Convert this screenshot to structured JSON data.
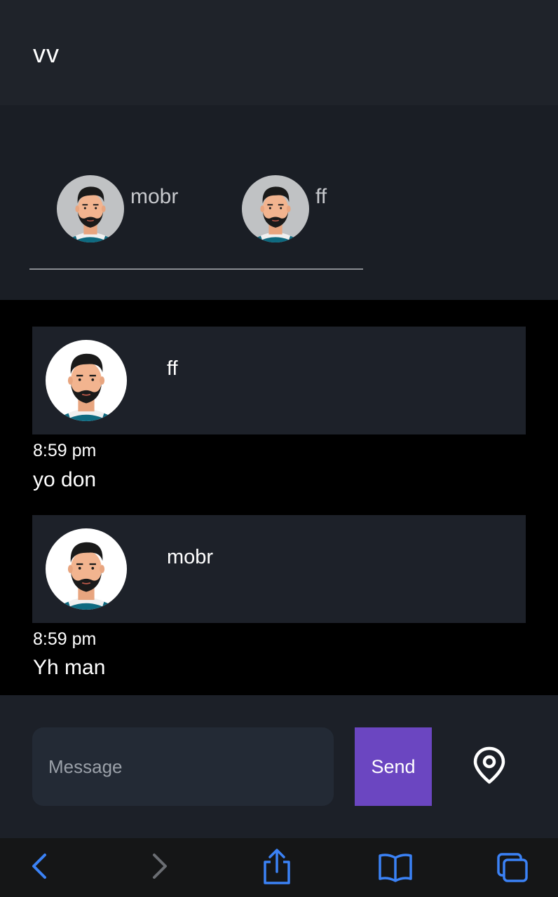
{
  "header": {
    "title": "vv"
  },
  "members": [
    {
      "name": "mobr",
      "avatar": "man-avatar-icon"
    },
    {
      "name": "ff",
      "avatar": "man-avatar-icon"
    }
  ],
  "messages": [
    {
      "user": "ff",
      "time": "8:59 pm",
      "text": "yo don",
      "avatar": "man-avatar-icon"
    },
    {
      "user": "mobr",
      "time": "8:59 pm",
      "text": "Yh man",
      "avatar": "man-avatar-icon"
    }
  ],
  "composer": {
    "placeholder": "Message",
    "value": "",
    "send_label": "Send",
    "location_icon": "location-pin-icon"
  },
  "browser_toolbar": {
    "icons": [
      "back-icon",
      "forward-icon",
      "share-icon",
      "bookmarks-icon",
      "tabs-icon"
    ]
  },
  "colors": {
    "accent": "#6b46c1",
    "header_bg": "#1f232a",
    "card_bg": "#1d2129",
    "safari_blue": "#3b82f6"
  }
}
